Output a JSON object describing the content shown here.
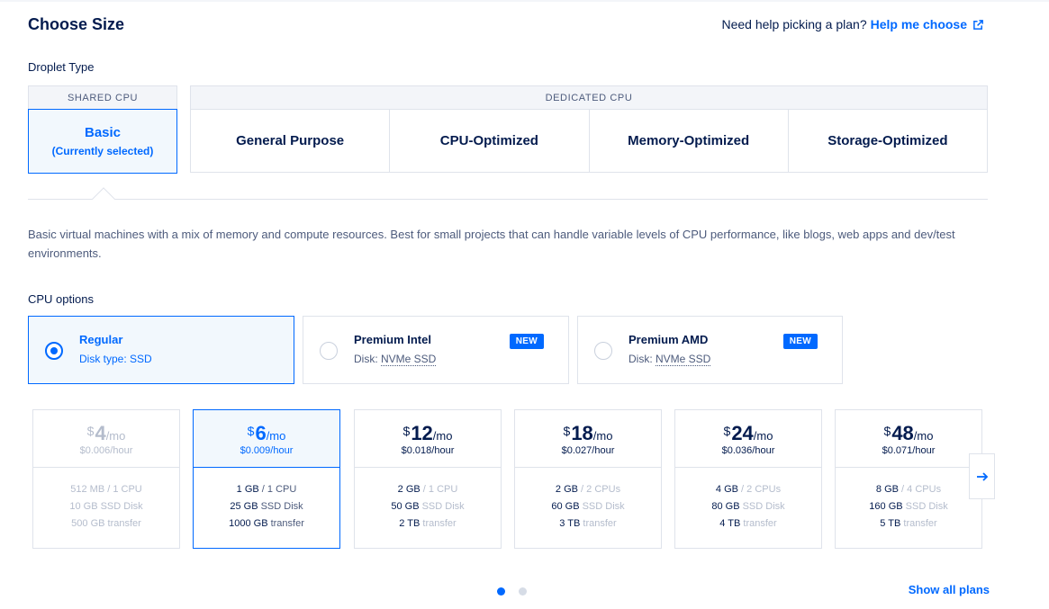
{
  "header": {
    "title": "Choose Size",
    "help_prompt": "Need help picking a plan?",
    "help_link": "Help me choose",
    "help_link_icon": "external-link-icon"
  },
  "droplet_type": {
    "label": "Droplet Type",
    "shared_group": "SHARED CPU",
    "dedicated_group": "DEDICATED CPU",
    "basic": {
      "label": "Basic",
      "status": "(Currently selected)"
    },
    "dedicated_options": [
      "General Purpose",
      "CPU-Optimized",
      "Memory-Optimized",
      "Storage-Optimized"
    ]
  },
  "description": "Basic virtual machines with a mix of memory and compute resources. Best for small projects that can handle variable levels of CPU performance, like blogs, web apps and dev/test environments.",
  "cpu_options": {
    "label": "CPU options",
    "items": [
      {
        "name": "Regular",
        "disk_prefix": "Disk type: ",
        "disk": "SSD",
        "badge": "",
        "selected": true
      },
      {
        "name": "Premium Intel",
        "disk_prefix": "Disk: ",
        "disk": "NVMe SSD",
        "badge": "NEW",
        "selected": false
      },
      {
        "name": "Premium AMD",
        "disk_prefix": "Disk: ",
        "disk": "NVMe SSD",
        "badge": "NEW",
        "selected": false
      }
    ]
  },
  "plans": [
    {
      "currency": "$",
      "amount": "4",
      "period": "/mo",
      "hourly": "$0.006",
      "hourly_unit": "/hour",
      "mem": "512 MB",
      "cpu": " / 1 CPU",
      "disk": "10 GB",
      "disk_unit": " SSD Disk",
      "transfer": "500 GB",
      "transfer_unit": " transfer",
      "state": "disabled"
    },
    {
      "currency": "$",
      "amount": "6",
      "period": "/mo",
      "hourly": "$0.009",
      "hourly_unit": "/hour",
      "mem": "1 GB",
      "cpu": " / 1 CPU",
      "disk": "25 GB",
      "disk_unit": " SSD Disk",
      "transfer": "1000 GB",
      "transfer_unit": " transfer",
      "state": "selected"
    },
    {
      "currency": "$",
      "amount": "12",
      "period": "/mo",
      "hourly": "$0.018",
      "hourly_unit": "/hour",
      "mem": "2 GB",
      "cpu": " / 1 CPU",
      "disk": "50 GB",
      "disk_unit": " SSD Disk",
      "transfer": "2 TB",
      "transfer_unit": " transfer",
      "state": "normal"
    },
    {
      "currency": "$",
      "amount": "18",
      "period": "/mo",
      "hourly": "$0.027",
      "hourly_unit": "/hour",
      "mem": "2 GB",
      "cpu": " / 2 CPUs",
      "disk": "60 GB",
      "disk_unit": " SSD Disk",
      "transfer": "3 TB",
      "transfer_unit": " transfer",
      "state": "normal"
    },
    {
      "currency": "$",
      "amount": "24",
      "period": "/mo",
      "hourly": "$0.036",
      "hourly_unit": "/hour",
      "mem": "4 GB",
      "cpu": " / 2 CPUs",
      "disk": "80 GB",
      "disk_unit": " SSD Disk",
      "transfer": "4 TB",
      "transfer_unit": " transfer",
      "state": "normal"
    },
    {
      "currency": "$",
      "amount": "48",
      "period": "/mo",
      "hourly": "$0.071",
      "hourly_unit": "/hour",
      "mem": "8 GB",
      "cpu": " / 4 CPUs",
      "disk": "160 GB",
      "disk_unit": " SSD Disk",
      "transfer": "5 TB",
      "transfer_unit": " transfer",
      "state": "normal"
    }
  ],
  "carousel": {
    "next_icon": "arrow-right-icon",
    "pages": 2,
    "current_page": 1
  },
  "show_all": "Show all plans",
  "colors": {
    "accent": "#0069ff",
    "text": "#031b4e",
    "muted": "#4d5b7c",
    "border": "#dfe3eb"
  }
}
